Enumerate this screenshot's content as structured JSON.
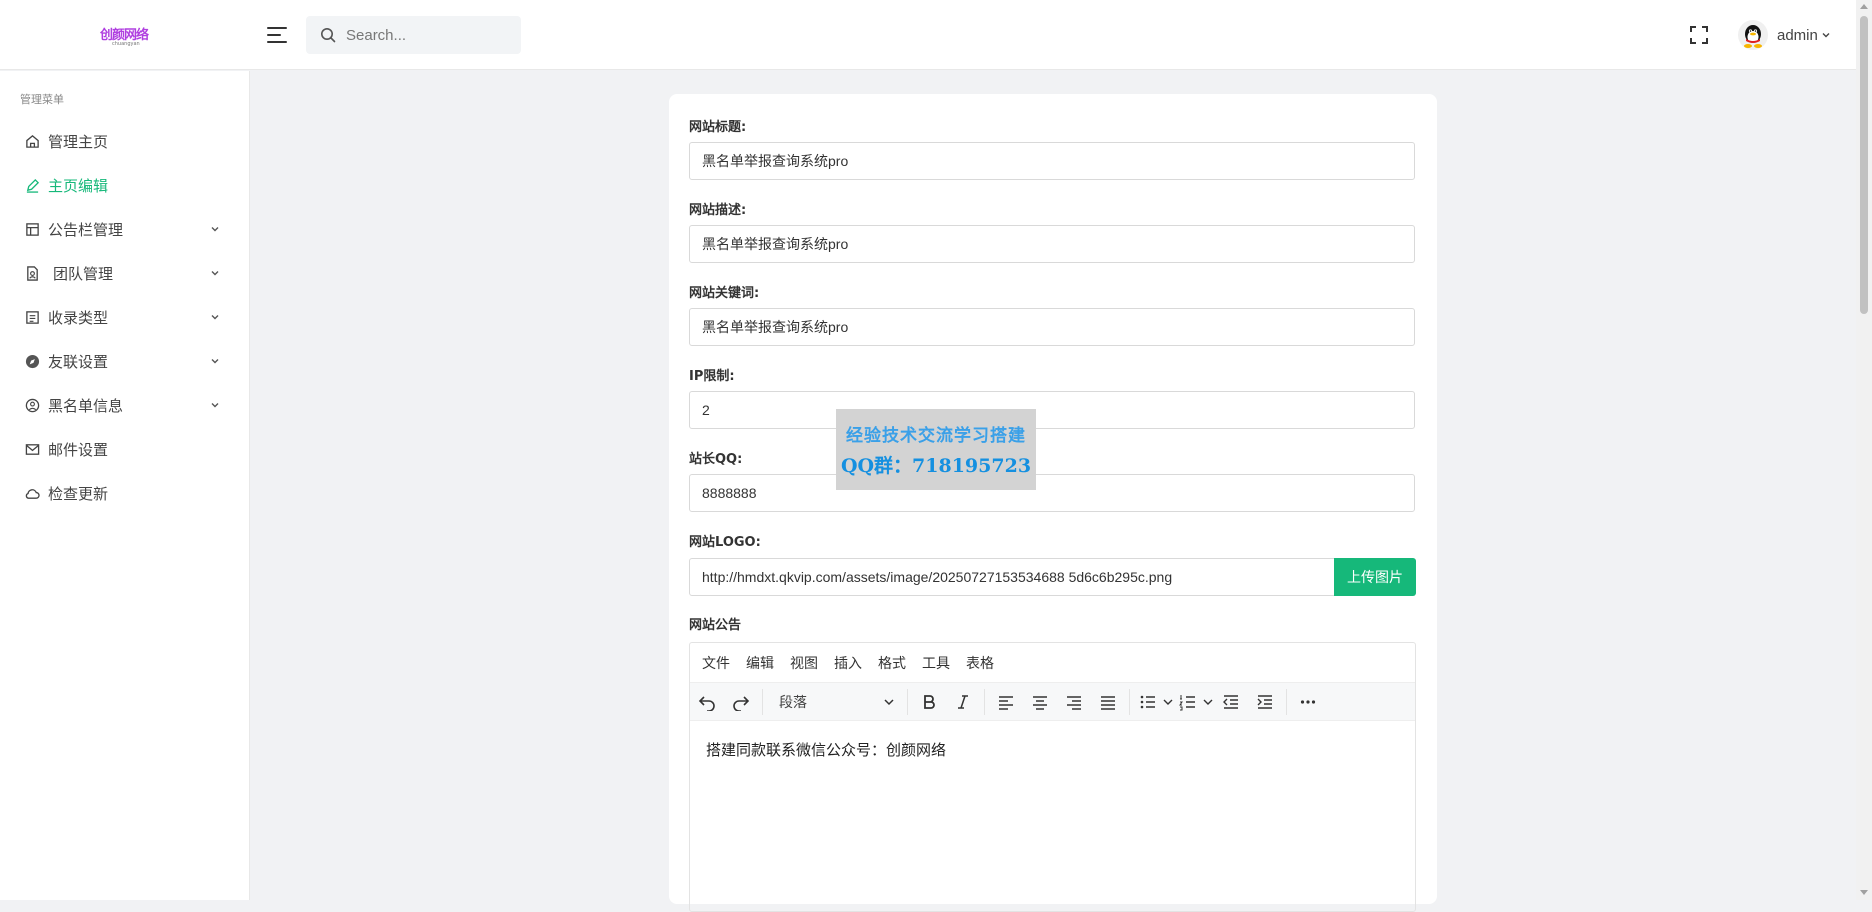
{
  "header": {
    "logo_text": "创颜网络",
    "logo_sub": "chuangyan",
    "search_placeholder": "Search...",
    "username": "admin"
  },
  "sidebar": {
    "title": "管理菜单",
    "items": [
      {
        "label": "管理主页",
        "icon": "home-icon"
      },
      {
        "label": "主页编辑",
        "icon": "edit-icon",
        "active": true
      },
      {
        "label": "公告栏管理",
        "icon": "layout-icon",
        "expandable": true
      },
      {
        "label": "团队管理",
        "icon": "badge-icon",
        "expandable": true
      },
      {
        "label": "收录类型",
        "icon": "list-icon",
        "expandable": true
      },
      {
        "label": "友联设置",
        "icon": "compass-icon",
        "expandable": true
      },
      {
        "label": "黑名单信息",
        "icon": "user-pin-icon",
        "expandable": true
      },
      {
        "label": "邮件设置",
        "icon": "mail-icon"
      },
      {
        "label": "检查更新",
        "icon": "cloud-icon"
      }
    ]
  },
  "form": {
    "site_title_label": "网站标题:",
    "site_title_value": "黑名单举报查询系统pro",
    "site_desc_label": "网站描述:",
    "site_desc_value": "黑名单举报查询系统pro",
    "site_keywords_label": "网站关键词:",
    "site_keywords_value": "黑名单举报查询系统pro",
    "ip_limit_label": "IP限制:",
    "ip_limit_value": "2",
    "admin_qq_label": "站长QQ:",
    "admin_qq_value": "8888888",
    "logo_label": "网站LOGO:",
    "logo_value": "http://hmdxt.qkvip.com/assets/image/20250727153534688 5d6c6b295c.png",
    "upload_button": "上传图片",
    "notice_label": "网站公告"
  },
  "editor": {
    "menus": [
      "文件",
      "编辑",
      "视图",
      "插入",
      "格式",
      "工具",
      "表格"
    ],
    "block_format": "段落",
    "content": "搭建同款联系微信公众号：创颜网络"
  },
  "watermark": {
    "line1": "经验技术交流学习搭建",
    "line2": "QQ群：718195723"
  },
  "colors": {
    "accent": "#16b87a",
    "watermark_text": "#1590e0"
  }
}
